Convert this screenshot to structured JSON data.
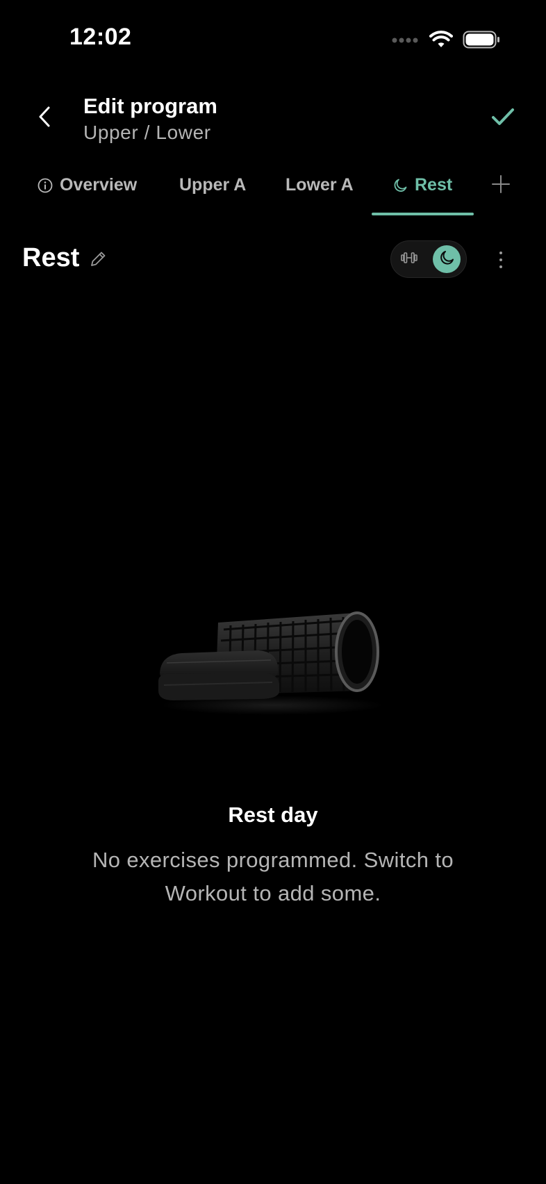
{
  "status_bar": {
    "time": "12:02",
    "signal_icon": "signal-dots-icon",
    "wifi_icon": "wifi-icon",
    "battery_icon": "battery-icon"
  },
  "header": {
    "back_icon": "chevron-left-icon",
    "title": "Edit program",
    "subtitle": "Upper / Lower",
    "confirm_icon": "checkmark-icon"
  },
  "tabs": [
    {
      "label": "Overview",
      "icon": "info-icon",
      "active": false
    },
    {
      "label": "Upper A",
      "active": false
    },
    {
      "label": "Lower A",
      "active": false
    },
    {
      "label": "Rest",
      "icon": "moon-icon",
      "active": true
    }
  ],
  "add_tab_icon": "plus-icon",
  "day": {
    "title": "Rest",
    "edit_icon": "pencil-icon",
    "mode_options": [
      {
        "name": "workout",
        "icon": "dumbbell-icon",
        "selected": false
      },
      {
        "name": "rest",
        "icon": "moon-icon",
        "selected": true
      }
    ],
    "more_icon": "more-vertical-icon"
  },
  "empty_state": {
    "title": "Rest day",
    "text": "No exercises programmed. Switch to Workout to add some."
  },
  "colors": {
    "accent": "#6fbfa8",
    "background": "#000000",
    "muted_text": "#b5b5b5"
  }
}
